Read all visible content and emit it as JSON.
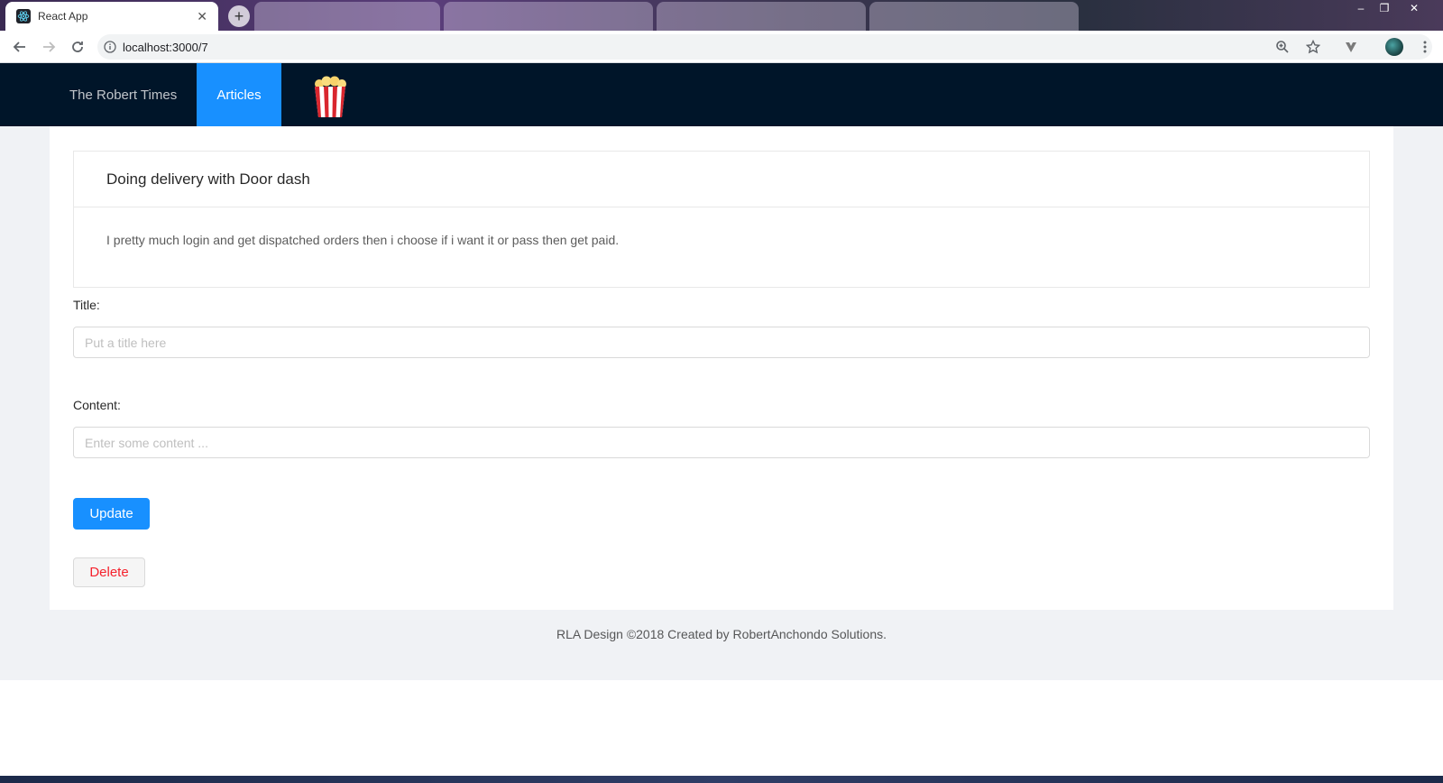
{
  "browser": {
    "active_tab": {
      "title": "React App",
      "icon": "react-icon"
    },
    "inactive_tabs": [
      "",
      "",
      "",
      ""
    ],
    "url": "localhost:3000/7"
  },
  "header": {
    "brand": "The Robert Times",
    "active_menu": "Articles",
    "logo_icon": "popcorn-icon",
    "background": "#001529",
    "accent": "#1890ff"
  },
  "article": {
    "title": "Doing delivery with Door dash",
    "content": "I pretty much login and get dispatched orders then i choose if i want it or pass then get paid."
  },
  "form": {
    "title_label": "Title:",
    "title_placeholder": "Put a title here",
    "content_label": "Content:",
    "content_placeholder": "Enter some content ...",
    "update_label": "Update",
    "delete_label": "Delete"
  },
  "footer": {
    "text": "RLA Design ©2018 Created by RobertAnchondo Solutions."
  }
}
